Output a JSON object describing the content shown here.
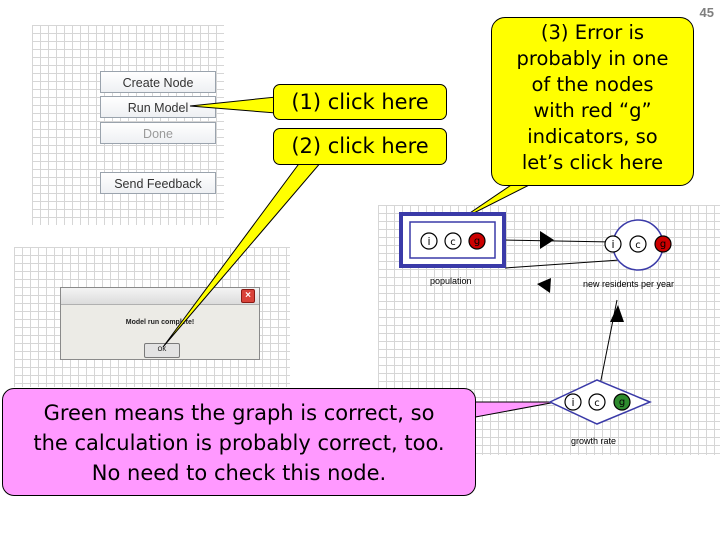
{
  "slide_number": "45",
  "menu": {
    "create_node": "Create Node",
    "run_model": "Run Model",
    "done": "Done",
    "send_feedback": "Send Feedback"
  },
  "dialog": {
    "message": "Model run complete!",
    "ok_label": "OK",
    "close_icon": "close-icon"
  },
  "callouts": {
    "click_here_1": "(1) click here",
    "click_here_2": "(2) click here",
    "error_note_lines": [
      "(3) Error is",
      "probably in one",
      "of the nodes",
      "with red “g”",
      "indicators, so",
      "let’s click here"
    ],
    "green_note_lines": [
      "Green means the graph is correct, so",
      "the calculation is probably correct, too.",
      "No need to check this node."
    ]
  },
  "model": {
    "nodes": [
      {
        "name": "population",
        "label": "population",
        "indicators": [
          "i",
          "c",
          "g"
        ],
        "g_status": "red"
      },
      {
        "name": "new-residents-per-year",
        "label": "new residents per year",
        "indicators": [
          "i",
          "c",
          "g"
        ],
        "g_status": "red"
      },
      {
        "name": "growth-rate",
        "label": "growth rate",
        "indicators": [
          "i",
          "c",
          "g"
        ],
        "g_status": "green"
      }
    ]
  },
  "colors": {
    "callout_yellow": "#ffff00",
    "callout_pink": "#ff99ff",
    "g_red": "#cc0000",
    "g_green": "#2e8b2e",
    "node_border": "#3a3aa8"
  }
}
